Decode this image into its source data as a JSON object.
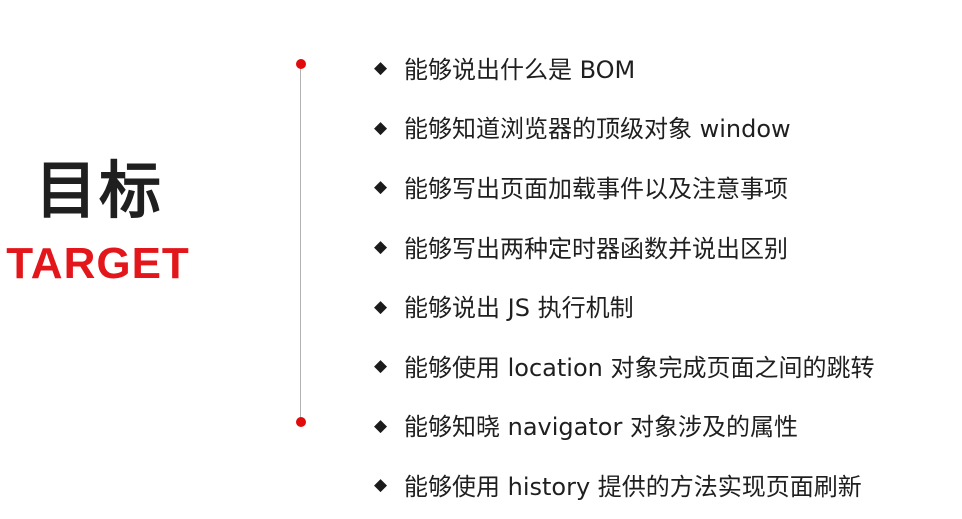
{
  "title": {
    "cn": "目标",
    "en": "TARGET"
  },
  "goals": [
    "能够说出什么是 BOM",
    "能够知道浏览器的顶级对象 window",
    "能够写出页面加载事件以及注意事项",
    "能够写出两种定时器函数并说出区别",
    "能够说出 JS 执行机制",
    "能够使用 location 对象完成页面之间的跳转",
    "能够知晓 navigator 对象涉及的属性",
    "能够使用 history 提供的方法实现页面刷新"
  ],
  "bullet_glyph": "◆",
  "colors": {
    "accent_red": "#e3161b",
    "timeline_dot": "#e10b0b",
    "timeline_line": "#b3b3b3",
    "text_dark": "#1f1f1f"
  },
  "icons": {
    "bullet": "diamond-bullet-icon",
    "timeline_dot": "timeline-dot-icon"
  }
}
